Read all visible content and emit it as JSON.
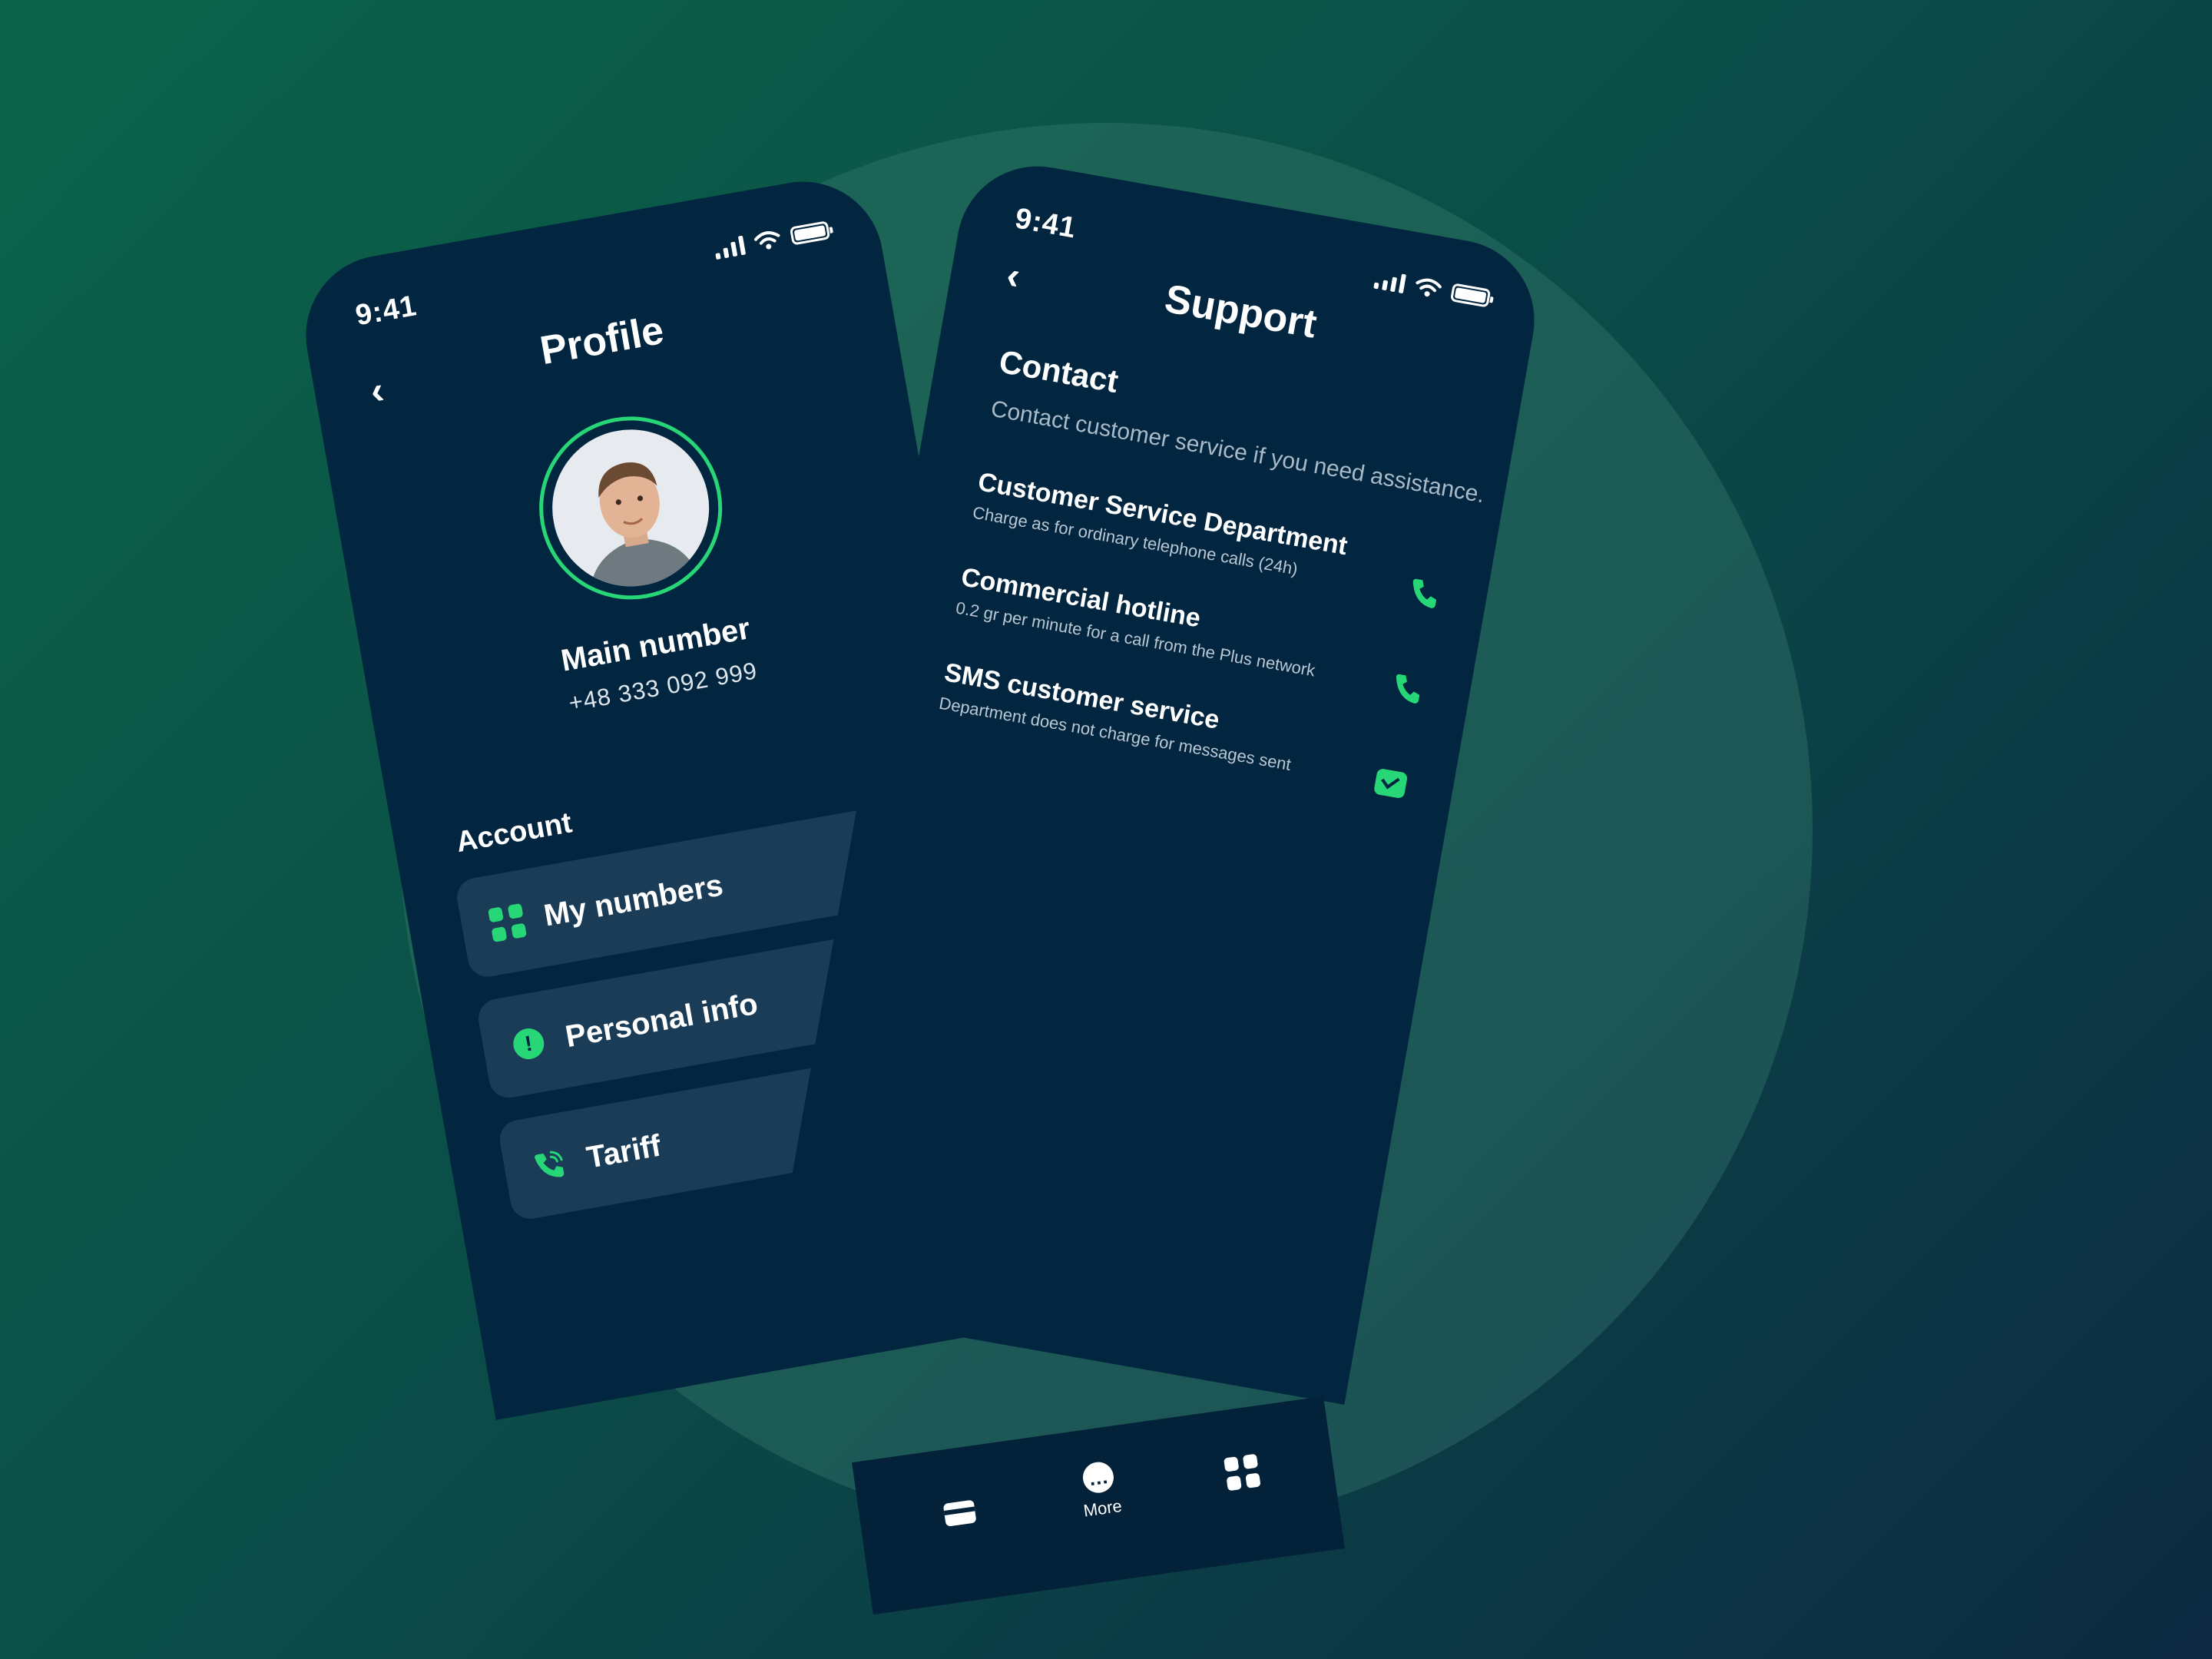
{
  "profile_screen": {
    "status_time": "9:41",
    "title": "Profile",
    "main_number_label": "Main number",
    "main_number": "+48 333 092 999",
    "account_section": "Account",
    "menu_items": [
      {
        "label": "My numbers",
        "icon": "grid-icon"
      },
      {
        "label": "Personal info",
        "icon": "info-icon"
      },
      {
        "label": "Tariff",
        "icon": "phone-signal-icon"
      }
    ]
  },
  "support_screen": {
    "status_time": "9:41",
    "title": "Support",
    "section_title": "Contact",
    "section_description": "Contact customer service if you need assistance.",
    "contacts": [
      {
        "title": "Customer Service Department",
        "subtitle": "Charge as for ordinary telephone calls (24h)",
        "icon": "phone-icon"
      },
      {
        "title": "Commercial hotline",
        "subtitle": "0.2 gr per minute for a call from the Plus network",
        "icon": "phone-icon"
      },
      {
        "title": "SMS customer service",
        "subtitle": "Department does not charge for messages sent",
        "icon": "mail-icon"
      }
    ]
  },
  "tab_bar": {
    "tabs": [
      {
        "icon": "card-icon"
      },
      {
        "label": "More",
        "icon": "more-icon"
      },
      {
        "icon": "grid-icon"
      }
    ]
  },
  "colors": {
    "background": "#0b5548",
    "phone_bg": "#022640",
    "card_bg": "#1b3c57",
    "accent": "#27d676"
  }
}
